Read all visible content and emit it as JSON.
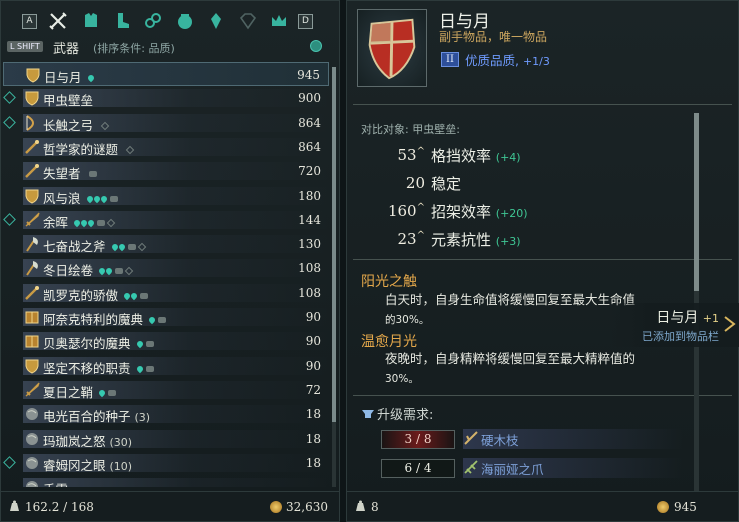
{
  "left_panel": {
    "key_left": "A",
    "key_right": "D",
    "tabs": [
      "crossed-swords-icon",
      "armor-icon",
      "boot-icon",
      "rings-icon",
      "satchel-icon",
      "crystal-icon",
      "diamond-icon",
      "crown-icon"
    ],
    "sort_key": "L SHIFT",
    "category_title": "武器",
    "sort_label": "(排序条件: 品质)",
    "items": [
      {
        "name": "日与月",
        "value": "945",
        "selected": true,
        "icon": "shield-icon",
        "marks": "f",
        "new": false
      },
      {
        "name": "甲虫壁垒",
        "value": "900",
        "selected": false,
        "icon": "shield-icon",
        "marks": "",
        "new": true
      },
      {
        "name": "长触之弓",
        "value": "864",
        "selected": false,
        "icon": "bow-icon",
        "marks": "d",
        "new": true
      },
      {
        "name": "哲学家的谜题",
        "value": "864",
        "selected": false,
        "icon": "staff-icon",
        "marks": "d",
        "new": false
      },
      {
        "name": "失望者",
        "value": "720",
        "selected": false,
        "icon": "staff-icon",
        "marks": "g",
        "new": false
      },
      {
        "name": "风与浪",
        "value": "180",
        "selected": false,
        "icon": "shield-icon",
        "marks": "fffg",
        "new": false
      },
      {
        "name": "余晖",
        "value": "144",
        "selected": false,
        "icon": "sword-icon",
        "marks": "fffgd",
        "new": true
      },
      {
        "name": "七奋战之斧",
        "value": "130",
        "selected": false,
        "icon": "axe-icon",
        "marks": "ffgd",
        "new": false
      },
      {
        "name": "冬日绘卷",
        "value": "108",
        "selected": false,
        "icon": "axe-icon",
        "marks": "ffgd",
        "new": false
      },
      {
        "name": "凯罗克的骄傲",
        "value": "108",
        "selected": false,
        "icon": "staff-icon",
        "marks": "ffg",
        "new": false
      },
      {
        "name": "阿奈克特利的魔典",
        "value": "90",
        "selected": false,
        "icon": "tome-icon",
        "marks": "fg",
        "new": false
      },
      {
        "name": "贝奥瑟尔的魔典",
        "value": "90",
        "selected": false,
        "icon": "tome-icon",
        "marks": "fg",
        "new": false
      },
      {
        "name": "坚定不移的职责",
        "value": "90",
        "selected": false,
        "icon": "shield-icon",
        "marks": "fg",
        "new": false
      },
      {
        "name": "夏日之鞘",
        "value": "72",
        "selected": false,
        "icon": "sword-icon",
        "marks": "fg",
        "new": false
      },
      {
        "name": "电光百合的种子",
        "count": "(3)",
        "value": "18",
        "selected": false,
        "icon": "orb-icon",
        "marks": "",
        "new": false
      },
      {
        "name": "玛珈岚之怒",
        "count": "(30)",
        "value": "18",
        "selected": false,
        "icon": "orb-icon",
        "marks": "",
        "new": false
      },
      {
        "name": "睿姆冈之眼",
        "count": "(10)",
        "value": "18",
        "selected": false,
        "icon": "orb-icon",
        "marks": "",
        "new": true
      },
      {
        "name": "手雷",
        "value": "",
        "selected": false,
        "icon": "orb-icon",
        "marks": "",
        "new": false
      }
    ],
    "weight": "162.2 / 168",
    "gold": "32,630"
  },
  "item_detail": {
    "name": "日与月",
    "type": "副手物品，唯一物品",
    "tier": "II",
    "quality": "优质品质,",
    "quality_bonus": "+1/3",
    "compare_label": "对比对象:   甲虫壁垒:",
    "stats": [
      {
        "value": "53",
        "caret": "^",
        "name": "格挡效率",
        "delta": "(+4)"
      },
      {
        "value": "20",
        "caret": "",
        "name": "稳定",
        "delta": ""
      },
      {
        "value": "160",
        "caret": "^",
        "name": "招架效率",
        "delta": "(+20)"
      },
      {
        "value": "23",
        "caret": "^",
        "name": "元素抗性",
        "delta": "(+3)"
      }
    ],
    "skills": [
      {
        "title": "阳光之触",
        "line1": "白天时，自身生命值将缓慢回复至最大生命值",
        "line2": "的30%。"
      },
      {
        "title": "温愈月光",
        "line1": "夜晚时，自身精粹将缓慢回复至最大精粹值的",
        "line2": "30%。"
      }
    ],
    "upgrade_title": "升级需求:",
    "materials": [
      {
        "count": "3 / 8",
        "name": "硬木枝",
        "enough": false
      },
      {
        "count": "6 / 4",
        "name": "海丽娅之爪",
        "enough": true
      }
    ],
    "weight": "8",
    "gold": "945"
  },
  "toast": {
    "name": "日与月",
    "plus": "+1",
    "subtitle": "已添加到物品栏"
  },
  "colors": {
    "accent": "#36c9b0",
    "gold": "#c9a45e",
    "quality": "#6f9bff",
    "skill": "#e4a84b",
    "delta": "#3fc694"
  }
}
